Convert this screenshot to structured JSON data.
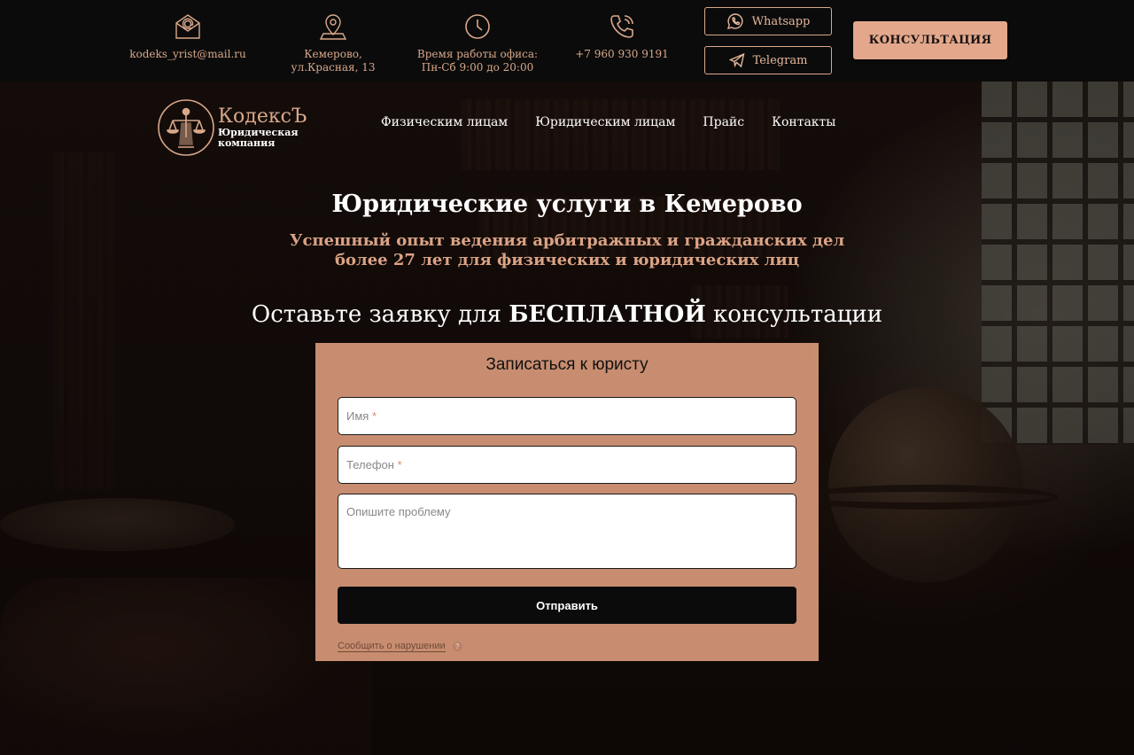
{
  "topbar": {
    "email": "kodeks_yrist@mail.ru",
    "address": "Кемерово, ул.Красная, 13",
    "hours_label": "Время работы офиса:",
    "hours_value": "Пн-Сб 9:00 до 20:00",
    "phone": "+7 960 930 9191",
    "whatsapp_label": "Whatsapp",
    "telegram_label": "Telegram",
    "consult_label": "КОНСУЛЬТАЦИЯ",
    "icons": [
      "mail-icon",
      "location-pin-icon",
      "clock-icon",
      "phone-icon",
      "whatsapp-icon",
      "telegram-icon"
    ]
  },
  "brand": {
    "name": "КодексЪ",
    "subtitle": "Юридическая компания",
    "accent_color": "#e3a88b"
  },
  "nav": {
    "items": [
      "Физическим лицам",
      "Юридическим лицам",
      "Прайс",
      "Контакты"
    ]
  },
  "hero": {
    "title": "Юридические услуги в Кемерово",
    "subtitle_line1": "Успешный опыт ведения арбитражных и гражданских дел",
    "subtitle_line2": "более 27 лет для физических и юридических лиц",
    "cta_before": "Оставьте заявку для ",
    "cta_bold": "БЕСПЛАТНОЙ",
    "cta_after": " консультации"
  },
  "form": {
    "title": "Записаться к юристу",
    "name_placeholder": "Имя",
    "phone_placeholder": "Телефон",
    "required_mark": "*",
    "problem_placeholder": "Опишите проблему",
    "submit_label": "Отправить",
    "report_label": "Сообщить о нарушении",
    "help_glyph": "?"
  }
}
